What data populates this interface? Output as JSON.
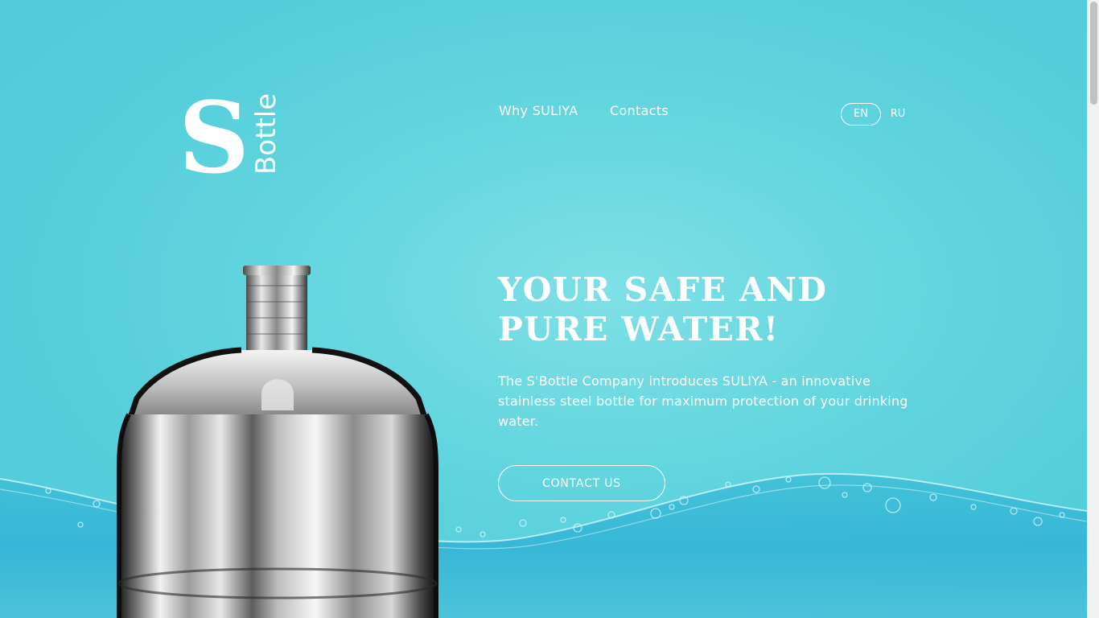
{
  "brand": {
    "logo_letter": "S",
    "logo_word": "Bottle"
  },
  "nav": {
    "items": [
      {
        "label": "Why SULIYA"
      },
      {
        "label": "Contacts"
      }
    ]
  },
  "language": {
    "options": [
      "EN",
      "RU"
    ],
    "active": "EN"
  },
  "hero": {
    "title_line1": "YOUR SAFE AND",
    "title_line2": "PURE WATER!",
    "description": "The S'Bottle Company introduces SULIYA - an innovative stainless steel bottle for maximum protection of your drinking water.",
    "cta_label": "CONTACT US"
  },
  "colors": {
    "background": "#5ad1dc",
    "text": "#ffffff",
    "scrollbar_track": "#f1f1f1",
    "scrollbar_thumb": "#c1c1c1"
  },
  "icons": {
    "product_image": "stainless-steel-bottle-image",
    "decoration": "water-splash-image"
  }
}
